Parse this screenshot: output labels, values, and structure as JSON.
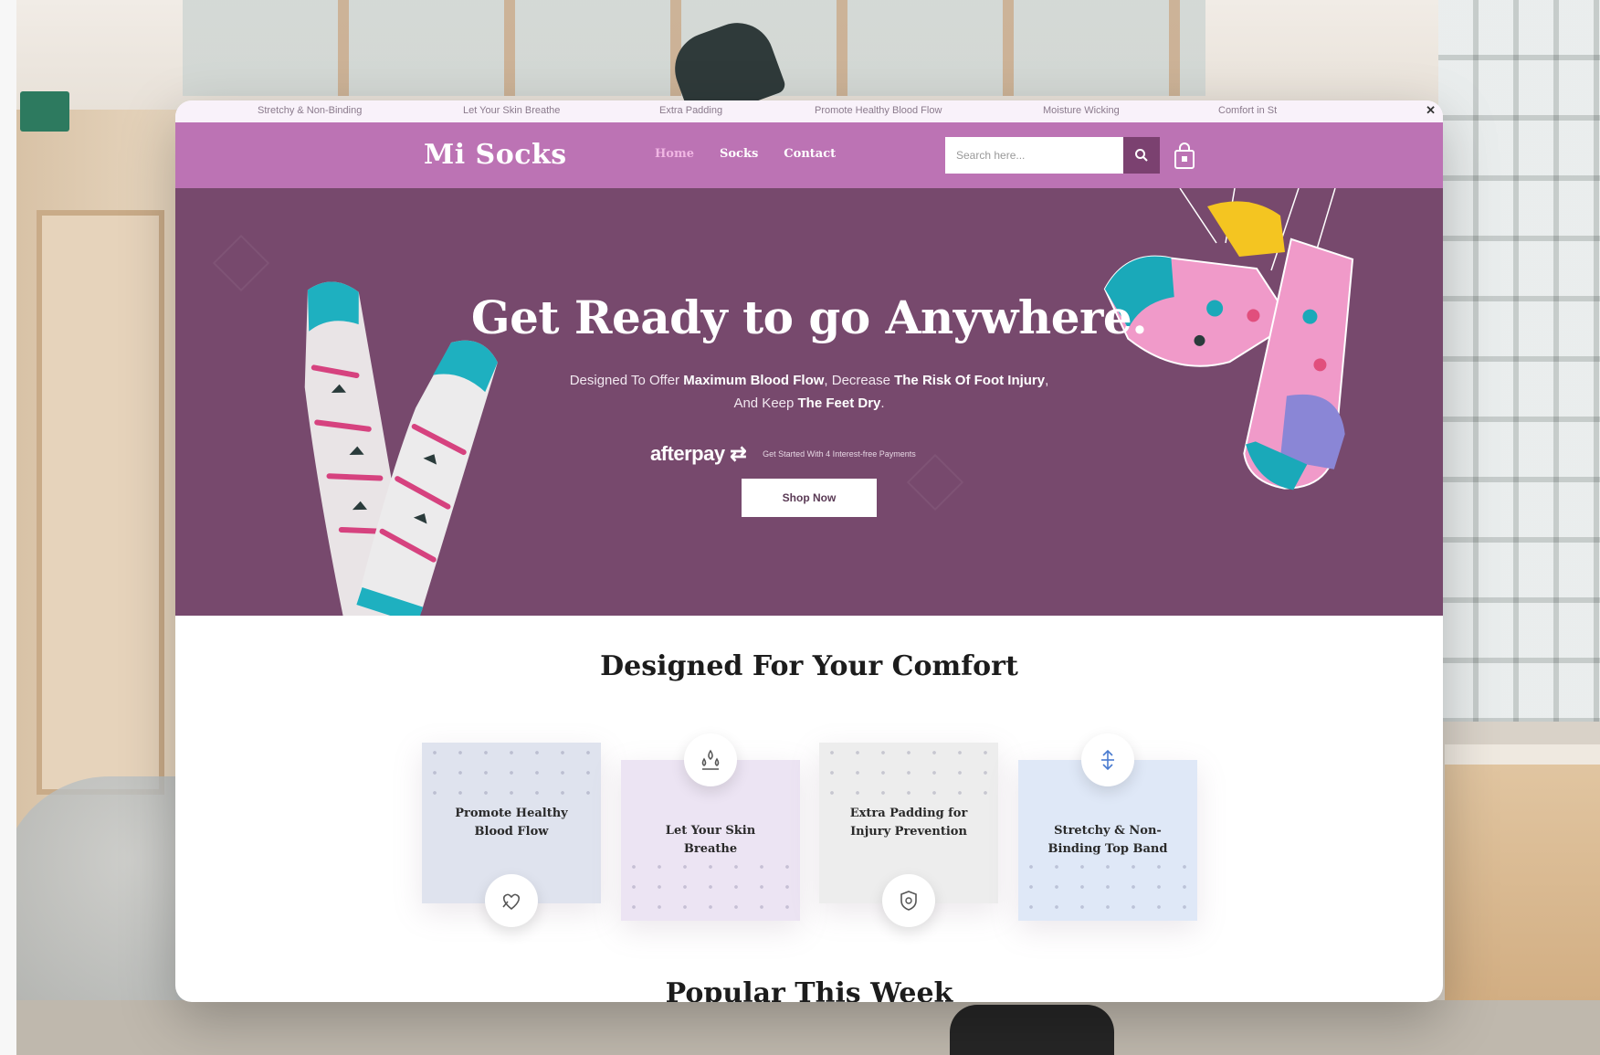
{
  "ticker": {
    "items": [
      "Stretchy & Non-Binding",
      "Let Your Skin Breathe",
      "Extra Padding",
      "Promote Healthy Blood Flow",
      "Moisture Wicking",
      "Comfort in St"
    ],
    "close_icon": "close-icon"
  },
  "header": {
    "logo": "Mi Socks",
    "nav": [
      "Home",
      "Socks",
      "Contact"
    ],
    "active_nav": "Home",
    "search_placeholder": "Search here...",
    "search_icon": "search-icon",
    "cart_icon": "shopping-bag-icon"
  },
  "hero": {
    "title": "Get Ready to go Anywhere.",
    "subtitle_parts": [
      "Designed To Offer ",
      "Maximum Blood Flow",
      ", Decrease ",
      "The Risk Of Foot Injury",
      ", And Keep ",
      "The Feet Dry",
      "."
    ],
    "afterpay_logo": "afterpay",
    "afterpay_note": "Get Started With 4 Interest-free Payments",
    "cta": "Shop Now"
  },
  "features": {
    "title": "Designed For Your Comfort",
    "items": [
      {
        "label": "Promote Healthy Blood Flow",
        "icon": "heart-hand-icon",
        "bg": "#dfe3ee"
      },
      {
        "label": "Let Your Skin Breathe",
        "icon": "droplets-icon",
        "bg": "#ece4f3"
      },
      {
        "label": "Extra Padding for Injury Prevention",
        "icon": "shield-icon",
        "bg": "#ededed"
      },
      {
        "label": "Stretchy & Non-Binding Top Band",
        "icon": "stretch-icon",
        "bg": "#dfe8f7"
      }
    ]
  },
  "popular": {
    "title": "Popular This Week"
  },
  "colors": {
    "nav": "#bc73b4",
    "hero": "#77496d",
    "accent": "#7b4170",
    "ticker_bg": "#f9f2fa"
  }
}
